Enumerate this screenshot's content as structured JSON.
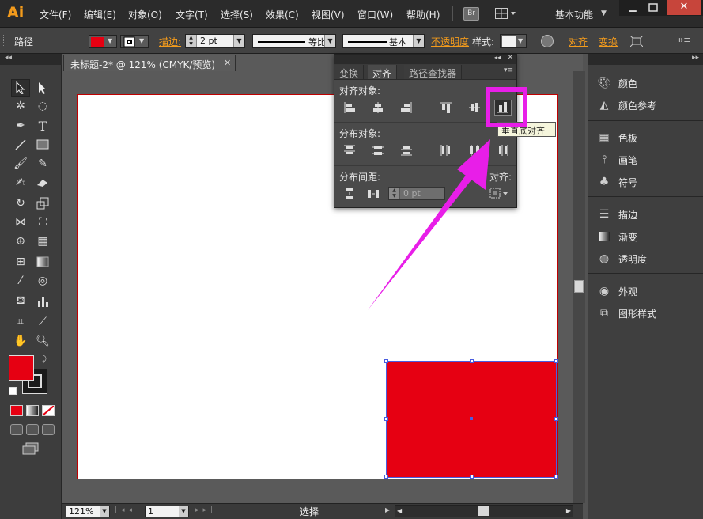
{
  "app": {
    "logo": "Ai"
  },
  "menu": {
    "items": [
      "文件(F)",
      "编辑(E)",
      "对象(O)",
      "文字(T)",
      "选择(S)",
      "效果(C)",
      "视图(V)",
      "窗口(W)",
      "帮助(H)"
    ],
    "bridge_label": "Br",
    "workspace": "基本功能"
  },
  "control_bar": {
    "selection_label": "路径",
    "stroke_label": "描边:",
    "stroke_value": "2 pt",
    "profile_label": "等比",
    "brush_label": "基本",
    "opacity_label": "不透明度",
    "style_label": "样式:",
    "align_label": "对齐",
    "transform_label": "变换",
    "fill_color": "#e60012"
  },
  "document": {
    "tab_title": "未标题-2* @ 121% (CMYK/预览)",
    "rect_color": "#e60012"
  },
  "align_panel": {
    "tabs": [
      "变换",
      "对齐",
      "路径查找器"
    ],
    "active_tab": 1,
    "align_objects_label": "对齐对象:",
    "distribute_objects_label": "分布对象:",
    "distribute_spacing_label": "分布间距:",
    "align_to_label": "对齐:",
    "spacing_value": "0 pt",
    "tooltip": "垂直底对齐",
    "highlight_color": "#e81ee8"
  },
  "right_dock": {
    "group1": [
      "颜色",
      "颜色参考"
    ],
    "group2": [
      "色板",
      "画笔",
      "符号"
    ],
    "group3": [
      "描边",
      "渐变",
      "透明度"
    ],
    "group4": [
      "外观",
      "图形样式"
    ]
  },
  "status_bar": {
    "zoom": "121%",
    "page": "1",
    "status_text": "选择"
  }
}
